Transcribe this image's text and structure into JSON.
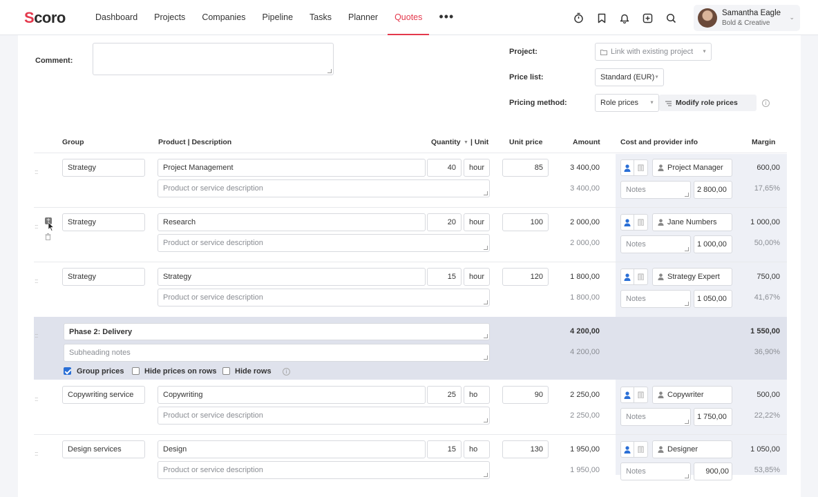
{
  "brand": {
    "logo": "Scoro",
    "accent": "#e4384c"
  },
  "nav": {
    "items": [
      "Dashboard",
      "Projects",
      "Companies",
      "Pipeline",
      "Tasks",
      "Planner",
      "Quotes"
    ],
    "active": "Quotes",
    "more": "•••"
  },
  "header_icons": [
    "timer-icon",
    "bookmark-icon",
    "bell-icon",
    "add-icon",
    "search-icon"
  ],
  "user": {
    "name": "Samantha Eagle",
    "company": "Bold & Creative"
  },
  "form": {
    "comment_label": "Comment:",
    "project_label": "Project:",
    "project_placeholder": "Link with existing project",
    "price_list_label": "Price list:",
    "price_list_value": "Standard (EUR)",
    "pricing_method_label": "Pricing method:",
    "pricing_method_value": "Role prices",
    "modify_role_prices": "Modify role prices"
  },
  "table": {
    "headers": {
      "group": "Group",
      "product": "Product | Description",
      "quantity": "Quantity",
      "unit": "| Unit",
      "unit_price": "Unit price",
      "amount": "Amount",
      "cost": "Cost and provider info",
      "margin": "Margin"
    },
    "description_placeholder": "Product or service description",
    "notes_placeholder": "Notes",
    "rows": [
      {
        "group": "Strategy",
        "product": "Project Management",
        "qty": "40",
        "unit": "hour",
        "price": "85",
        "amount": "3 400,00",
        "amount2": "3 400,00",
        "provider": "Project Manager",
        "cost": "2 800,00",
        "margin": "600,00",
        "margin_pct": "17,65%"
      },
      {
        "group": "Strategy",
        "product": "Research",
        "qty": "20",
        "unit": "hour",
        "price": "100",
        "amount": "2 000,00",
        "amount2": "2 000,00",
        "provider": "Jane Numbers",
        "cost": "1 000,00",
        "margin": "1 000,00",
        "margin_pct": "50,00%"
      },
      {
        "group": "Strategy",
        "product": "Strategy",
        "qty": "15",
        "unit": "hour",
        "price": "120",
        "amount": "1 800,00",
        "amount2": "1 800,00",
        "provider": "Strategy Expert",
        "cost": "1 050,00",
        "margin": "750,00",
        "margin_pct": "41,67%"
      },
      {
        "group": "Copywriting service",
        "product": "Copywriting",
        "qty": "25",
        "unit": "ho",
        "price": "90",
        "amount": "2 250,00",
        "amount2": "2 250,00",
        "provider": "Copywriter",
        "cost": "1 750,00",
        "margin": "500,00",
        "margin_pct": "22,22%"
      },
      {
        "group": "Design services",
        "product": "Design",
        "qty": "15",
        "unit": "ho",
        "price": "130",
        "amount": "1 950,00",
        "amount2": "1 950,00",
        "provider": "Designer",
        "cost": "900,00",
        "margin": "1 050,00",
        "margin_pct": "53,85%"
      }
    ],
    "phase": {
      "title": "Phase 2: Delivery",
      "subheading_placeholder": "Subheading notes",
      "amount": "4 200,00",
      "amount2": "4 200,00",
      "margin": "1 550,00",
      "margin_pct": "36,90%",
      "group_prices_label": "Group prices",
      "group_prices_checked": true,
      "hide_prices_label": "Hide prices on rows",
      "hide_prices_checked": false,
      "hide_rows_label": "Hide rows",
      "hide_rows_checked": false
    }
  }
}
